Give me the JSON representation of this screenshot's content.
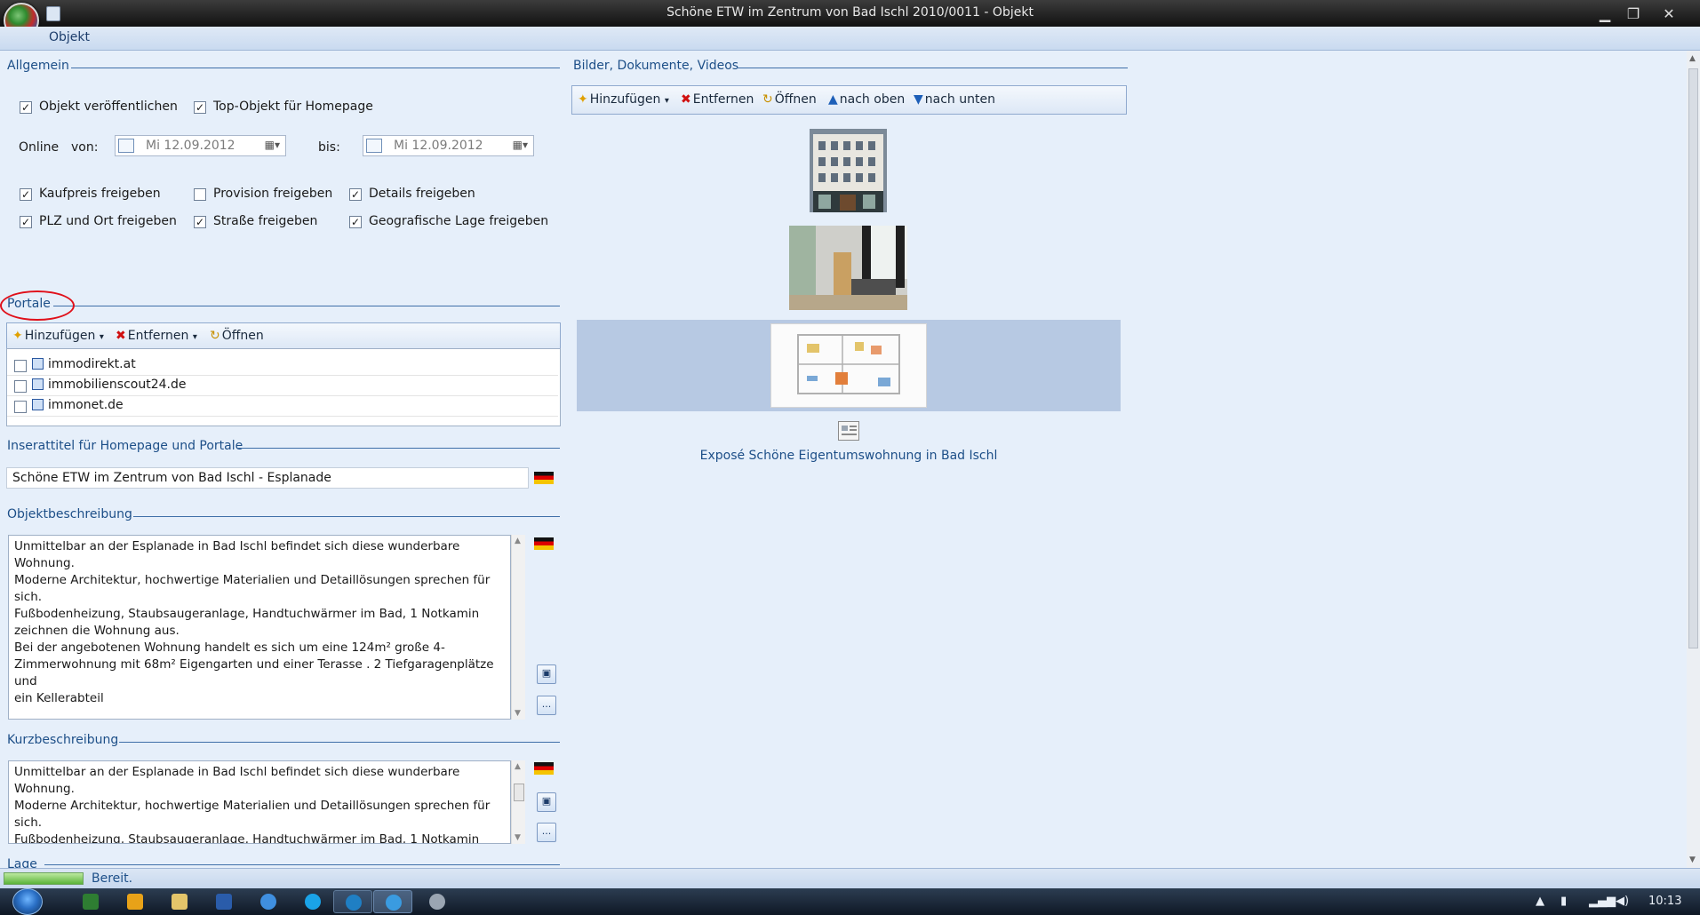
{
  "window": {
    "title": "Schöne ETW im Zentrum von Bad Ischl 2010/0011 - Objekt",
    "ribbon_tab": "Objekt"
  },
  "allgemein": {
    "header": "Allgemein",
    "checkboxes": [
      {
        "label": "Objekt veröffentlichen",
        "checked": true
      },
      {
        "label": "Top-Objekt für Homepage",
        "checked": true
      }
    ],
    "online_label": "Online",
    "von_label": "von:",
    "von_value": "Mi  12.09.2012",
    "bis_label": "bis:",
    "bis_value": "Mi  12.09.2012",
    "release_checkboxes": [
      {
        "label": "Kaufpreis freigeben",
        "checked": true
      },
      {
        "label": "Provision freigeben",
        "checked": false
      },
      {
        "label": "Details freigeben",
        "checked": true
      },
      {
        "label": "PLZ und Ort freigeben",
        "checked": true
      },
      {
        "label": "Straße freigeben",
        "checked": true
      },
      {
        "label": "Geografische Lage freigeben",
        "checked": true
      }
    ]
  },
  "portale": {
    "header": "Portale",
    "toolbar": {
      "add": "Hinzufügen",
      "remove": "Entfernen",
      "open": "Öffnen"
    },
    "items": [
      {
        "label": "immodirekt.at",
        "checked": false
      },
      {
        "label": "immobilienscout24.de",
        "checked": false
      },
      {
        "label": "immonet.de",
        "checked": false
      }
    ]
  },
  "inserat": {
    "header": "Inserattitel für Homepage und Portale",
    "value": "Schöne ETW im Zentrum von Bad Ischl - Esplanade"
  },
  "beschreibung": {
    "header": "Objektbeschreibung",
    "text": "Unmittelbar an der Esplanade in Bad Ischl befindet sich diese wunderbare\nWohnung.\nModerne Architektur, hochwertige Materialien und Detaillösungen sprechen für sich.\nFußbodenheizung, Staubsaugeranlage, Handtuchwärmer im Bad, 1 Notkamin\nzeichnen die Wohnung aus.\nBei der angebotenen Wohnung handelt es sich um eine 124m² große 4-\nZimmerwohnung mit 68m² Eigengarten und einer Terasse . 2 Tiefgaragenplätze und\nein Kellerabteil",
    "more_label": "..."
  },
  "kurz": {
    "header": "Kurzbeschreibung",
    "text": "Unmittelbar an der Esplanade in Bad Ischl befindet sich diese wunderbare\nWohnung.\nModerne Architektur, hochwertige Materialien und Detaillösungen sprechen für sich.\nFußbodenheizung, Staubsaugeranlage, Handtuchwärmer im Bad, 1 Notkamin",
    "more_label": "..."
  },
  "lage": {
    "header": "Lage"
  },
  "media": {
    "header": "Bilder, Dokumente, Videos",
    "toolbar": {
      "add": "Hinzufügen",
      "remove": "Entfernen",
      "open": "Öffnen",
      "up": "nach oben",
      "down": "nach unten"
    },
    "document_label": "Exposé Schöne Eigentumswohnung in Bad Ischl"
  },
  "status": {
    "text": "Bereit."
  },
  "taskbar": {
    "clock": "10:13"
  },
  "colors": {
    "accent": "#1d4f88",
    "highlight": "#b9cbe4",
    "annotation": "#e0101a"
  }
}
